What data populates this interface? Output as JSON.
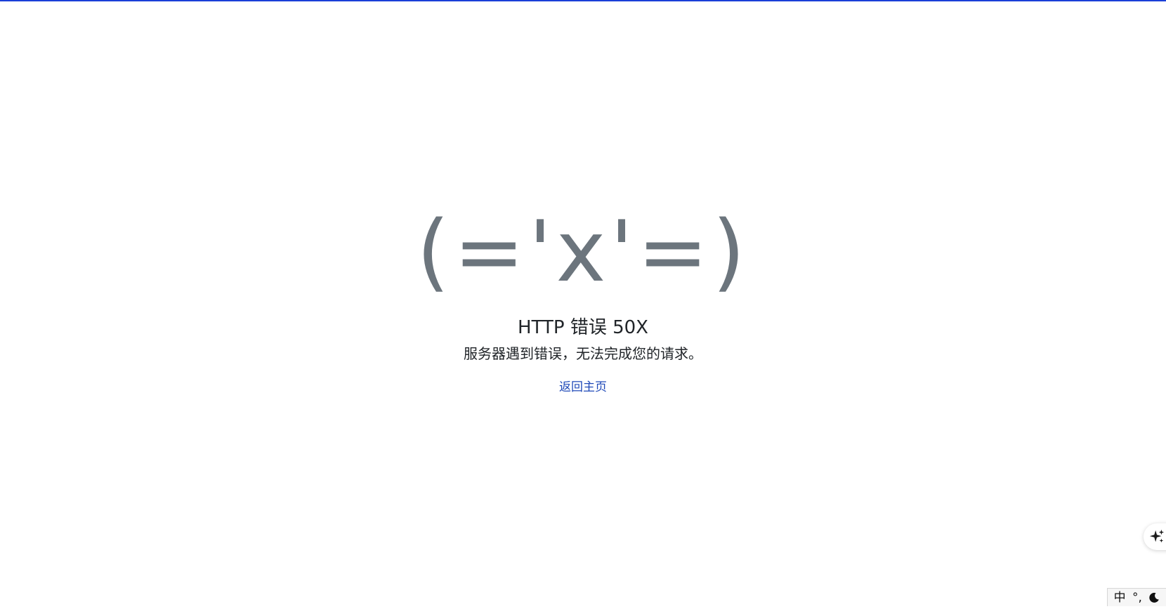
{
  "error": {
    "face": "(='x'=)",
    "title": "HTTP 错误 50X",
    "message": "服务器遇到错误，无法完成您的请求。",
    "home_link": "返回主页"
  },
  "ime": {
    "mode": "中",
    "punct": "°,"
  },
  "icons": {
    "assistant": "sparkle-icon",
    "theme": "moon-icon"
  },
  "colors": {
    "top_bar": "#1a3fd8",
    "face": "#6c757d",
    "text": "#212529",
    "link": "#1f49b8"
  }
}
